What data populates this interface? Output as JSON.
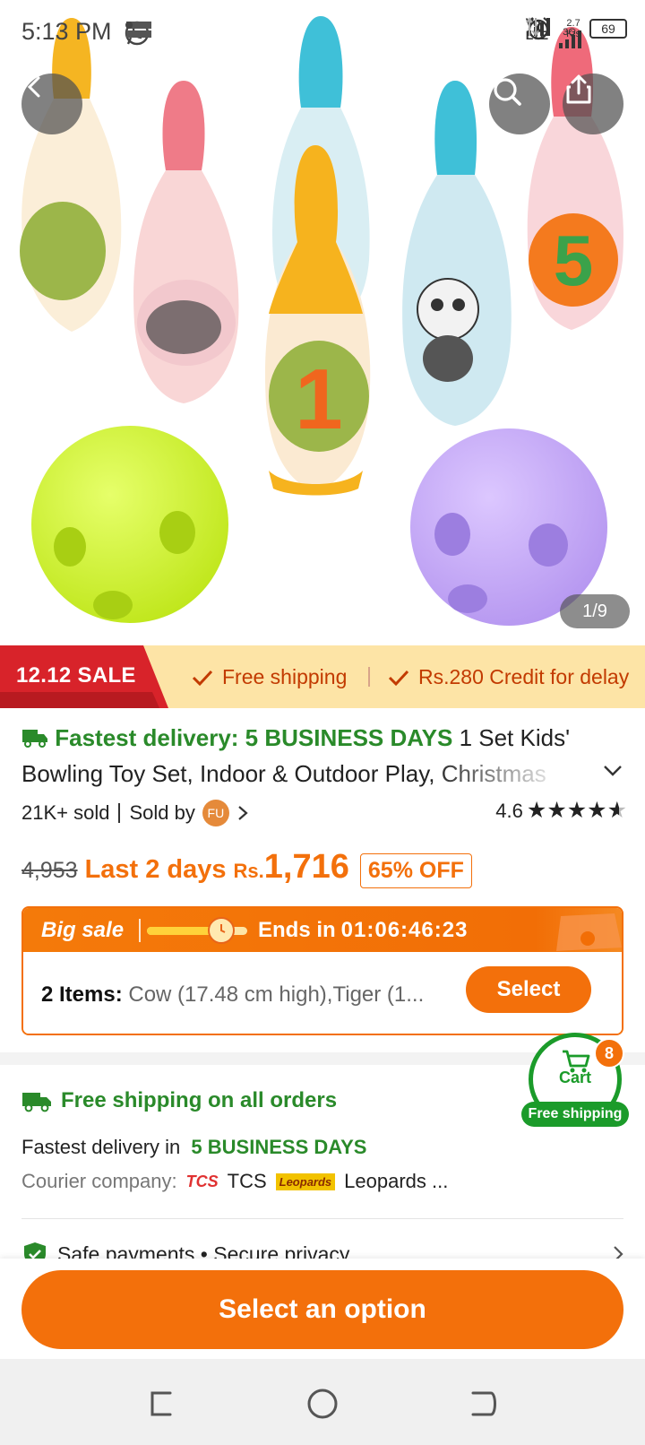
{
  "status_bar": {
    "time": "5:13 PM",
    "net_label_1": "Vo",
    "net_label_2": "LTE",
    "net_3g": "3G",
    "speed_value": "2.7",
    "speed_unit": "K/s",
    "battery": "69",
    "icons": [
      "whatsapp-icon",
      "temu-icon",
      "dot-icon",
      "alarm-icon",
      "signal-icon",
      "data-arrows-icon",
      "signal-icon"
    ]
  },
  "header": {
    "back_icon": "chevron-left-icon",
    "search_icon": "search-icon",
    "share_icon": "share-icon"
  },
  "gallery": {
    "pager": "1/9"
  },
  "sale_banner": {
    "tag": "12.12 SALE",
    "perk_1": "Free shipping",
    "perk_2": "Rs.280 Credit for delay"
  },
  "product": {
    "delivery_label": "Fastest delivery: 5 BUSINESS DAYS",
    "title_part_1": " 1 Set Kids'",
    "title_part_2": "Bowling Toy Set, Indoor & Outdoor Play, Christmas",
    "sold": "21K+ sold",
    "sold_by": "Sold by",
    "seller_initials": "FU",
    "rating": "4.6",
    "rating_stars": 4.6,
    "old_price": "4,953",
    "deal_text": "Last 2 days",
    "currency": "Rs.",
    "price": "1,716",
    "discount": "65% OFF"
  },
  "big_sale": {
    "label": "Big sale",
    "ends_label": "Ends in",
    "countdown": "01:06:46:23",
    "progress": 0.7,
    "items_label": "2 Items:",
    "items_value": "Cow (17.48 cm high),Tiger (1...",
    "select_label": "Select"
  },
  "shipping": {
    "title": "Free shipping on all orders",
    "fastest_label": "Fastest delivery in",
    "fastest_value": "5 BUSINESS DAYS",
    "courier_label": "Courier company:",
    "courier_1_logo": "TCS",
    "courier_1": "TCS",
    "courier_2_logo": "Leopards",
    "courier_2": "Leopards ..."
  },
  "safe": {
    "label": "Safe payments • Secure privacy"
  },
  "cart": {
    "label": "Cart",
    "badge": "Free shipping",
    "count": "8"
  },
  "cta": {
    "label": "Select an option"
  },
  "colors": {
    "accent": "#f3700b",
    "green": "#2a8a2a",
    "sale_red": "#d8232a",
    "banner_bg": "#fde4a6"
  }
}
